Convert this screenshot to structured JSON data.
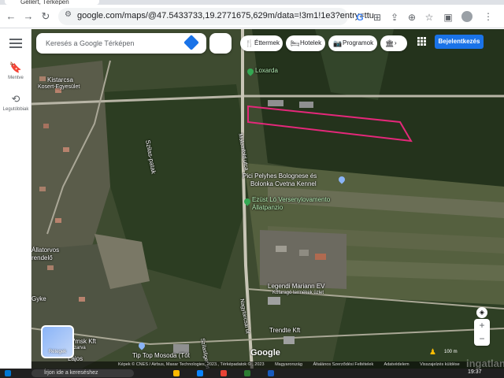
{
  "browser": {
    "tab_title": "Gellért, Térképen",
    "url": "google.com/maps/@47.5433733,19.2771675,629m/data=!3m1!1e3?entry=ttu"
  },
  "rail": {
    "saved_label": "Mentve",
    "recents_label": "Legutóbbiak"
  },
  "search": {
    "placeholder": "Keresés a Google Térképen"
  },
  "chips": [
    {
      "icon": "🍴",
      "label": "Éttermek"
    },
    {
      "icon": "🛏",
      "label": "Hotelek"
    },
    {
      "icon": "📷",
      "label": "Programok"
    },
    {
      "icon": "🏛",
      "label": ""
    }
  ],
  "signin_label": "Bejelentkezés",
  "labels": {
    "kistarcsa": "Kistarcsa",
    "kistarcsa2": "Kosert-Egyesület",
    "loxarda": "Loxarda",
    "szilas": "Szilas-patak",
    "pici": "Pici Pelyhes Bolognese és",
    "pici2": "Bolonka Cvetna Kennel",
    "ezust": "Ezüst Ló Versenylovamento",
    "ezust2": "Állatpanzio",
    "allatorvos": "Állatorvos",
    "allatorvos2": "rendelő",
    "legendi": "Legendi Mariann EV",
    "legendi2": "Kőfaragó termékek üzlet",
    "trendte": "Trendte Kft",
    "tiptop": "Tip Top Mosoda (Tót",
    "vmsk": "Vmsk Kft",
    "vmsk2": "zarva",
    "lajos": "Lajos",
    "utca": "Szilasliget utca",
    "nagytarcsai": "Nagytarcsai út",
    "malomfold": "Malomföld utca",
    "gyku": "Gyke"
  },
  "satellite_label": "Rétegek",
  "google_logo": "Google",
  "attribution": [
    "Képek © CNES / Airbus, Maxar Technologies, 2023., Térképadatok © , 2023",
    "Magyarország",
    "Általános Szerződési Feltételek",
    "Adatvédelem",
    "Visszajelzés küldése"
  ],
  "scale_label": "100 m",
  "taskbar": {
    "search_text": "Írjon ide a kereséshez",
    "time": "19:37"
  },
  "watermark": "ingatlan"
}
